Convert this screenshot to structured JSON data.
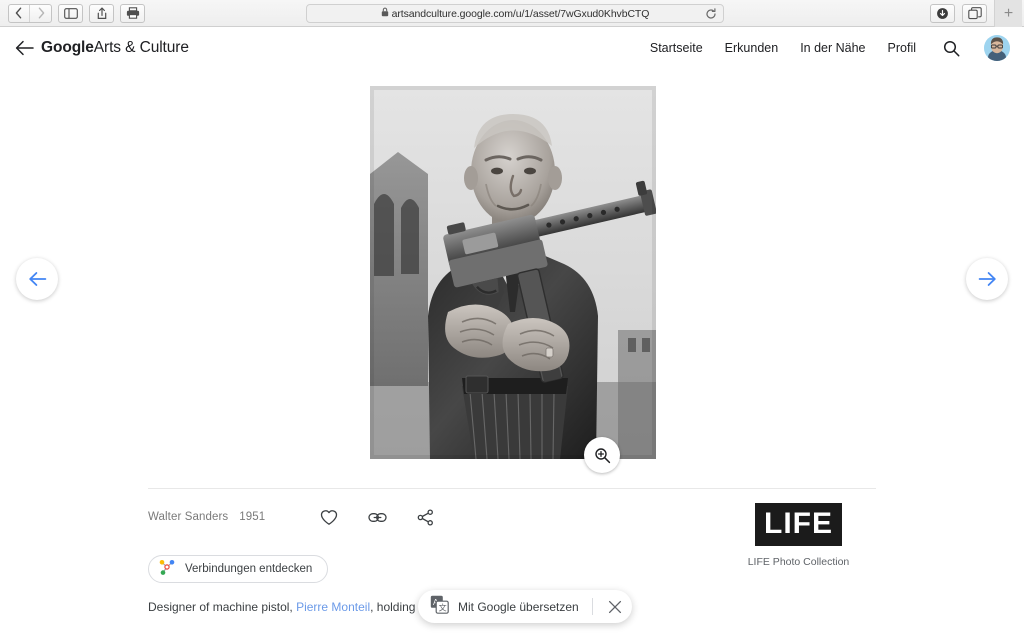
{
  "browser": {
    "url": "artsandculture.google.com/u/1/asset/7wGxud0KhvbCTQ",
    "lock_glyph": "🔒",
    "back_icon": "back-icon",
    "forward_icon": "forward-icon",
    "sidebar_icon": "sidebar-icon",
    "share_icon": "share-icon",
    "print_icon": "print-icon",
    "reload_icon": "reload-icon",
    "downloads_icon": "downloads-icon",
    "tabs_icon": "tab-overview-icon",
    "newtab_label": "+"
  },
  "header": {
    "back_label": "back-arrow",
    "brand_primary": "Google",
    "brand_secondary": "Arts & Culture",
    "nav": [
      {
        "label": "Startseite",
        "name": "nav-startseite"
      },
      {
        "label": "Erkunden",
        "name": "nav-erkunden"
      },
      {
        "label": "In der Nähe",
        "name": "nav-in-der-naehe"
      },
      {
        "label": "Profil",
        "name": "nav-profil"
      }
    ],
    "search_icon": "search-icon",
    "avatar": "user-avatar"
  },
  "artwork": {
    "alt": "Black and white photograph of an elderly man in a dark suit holding a machine pistol",
    "prev_label": "previous-artwork",
    "next_label": "next-artwork",
    "zoom_label": "zoom-in"
  },
  "info": {
    "artist": "Walter Sanders",
    "year": "1951",
    "favorite_icon": "heart-icon",
    "link_icon": "link-icon",
    "share_icon": "share-icon",
    "explore_label": "Verbindungen entdecken",
    "explore_icon": "connections-icon",
    "caption_before": "Designer of machine pistol, ",
    "caption_link": "Pierre Monteil",
    "caption_after": ", holding gun.",
    "partner_logo": "LIFE",
    "partner_name": "LIFE Photo Collection"
  },
  "translate_toast": {
    "label": "Mit Google übersetzen",
    "icon": "translate-icon",
    "close_label": "close-toast"
  },
  "colors": {
    "accent_blue": "#4285f4",
    "link_blue": "#6b9ae8",
    "text_primary": "#202124",
    "text_secondary": "#5f6368",
    "muted": "#7a7a7a"
  }
}
